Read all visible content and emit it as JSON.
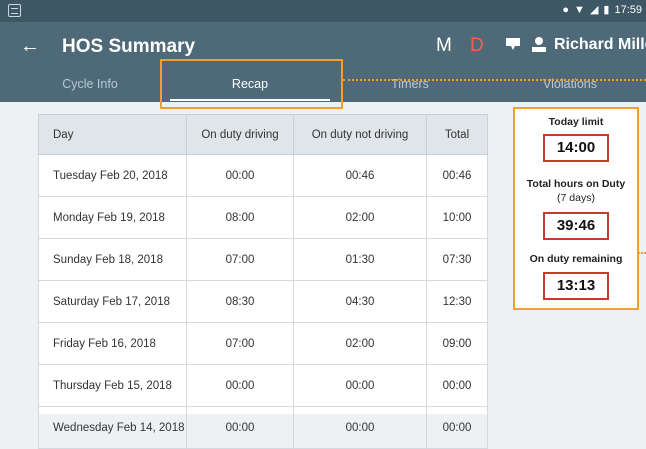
{
  "status_bar": {
    "time": "17:59"
  },
  "app_bar": {
    "back_glyph": "←",
    "title": "HOS Summary",
    "m_label": "M",
    "d_label": "D",
    "user_name": "Richard Miller"
  },
  "tabs": [
    {
      "label": "Cycle Info",
      "active": false
    },
    {
      "label": "Recap",
      "active": true
    },
    {
      "label": "Timers",
      "active": false
    },
    {
      "label": "Violations",
      "active": false
    }
  ],
  "table": {
    "headers": [
      "Day",
      "On duty driving",
      "On duty not driving",
      "Total"
    ],
    "rows": [
      [
        "Tuesday Feb 20, 2018",
        "00:00",
        "00:46",
        "00:46"
      ],
      [
        "Monday Feb 19, 2018",
        "08:00",
        "02:00",
        "10:00"
      ],
      [
        "Sunday Feb 18, 2018",
        "07:00",
        "01:30",
        "07:30"
      ],
      [
        "Saturday Feb 17, 2018",
        "08:30",
        "04:30",
        "12:30"
      ],
      [
        "Friday Feb 16, 2018",
        "07:00",
        "02:00",
        "09:00"
      ],
      [
        "Thursday Feb 15, 2018",
        "00:00",
        "00:00",
        "00:00"
      ],
      [
        "Wednesday Feb 14, 2018",
        "00:00",
        "00:00",
        "00:00"
      ]
    ]
  },
  "summary": {
    "today_limit_label": "Today limit",
    "today_limit_value": "14:00",
    "total_hours_label": "Total hours on Duty",
    "total_hours_sub": "(7 days)",
    "total_hours_value": "39:46",
    "remaining_label": "On duty remaining",
    "remaining_value": "13:13"
  },
  "colors": {
    "app_bar": "#4e6a78",
    "status_bar": "#3e5764",
    "highlight": "#f0a030",
    "value_border": "#c93b2a",
    "d_label": "#ff5b4a"
  },
  "icons": [
    "screen-icon",
    "location-icon",
    "wifi-icon",
    "signal-icon",
    "battery-icon",
    "back-arrow-icon",
    "chat-icon",
    "person-icon"
  ]
}
